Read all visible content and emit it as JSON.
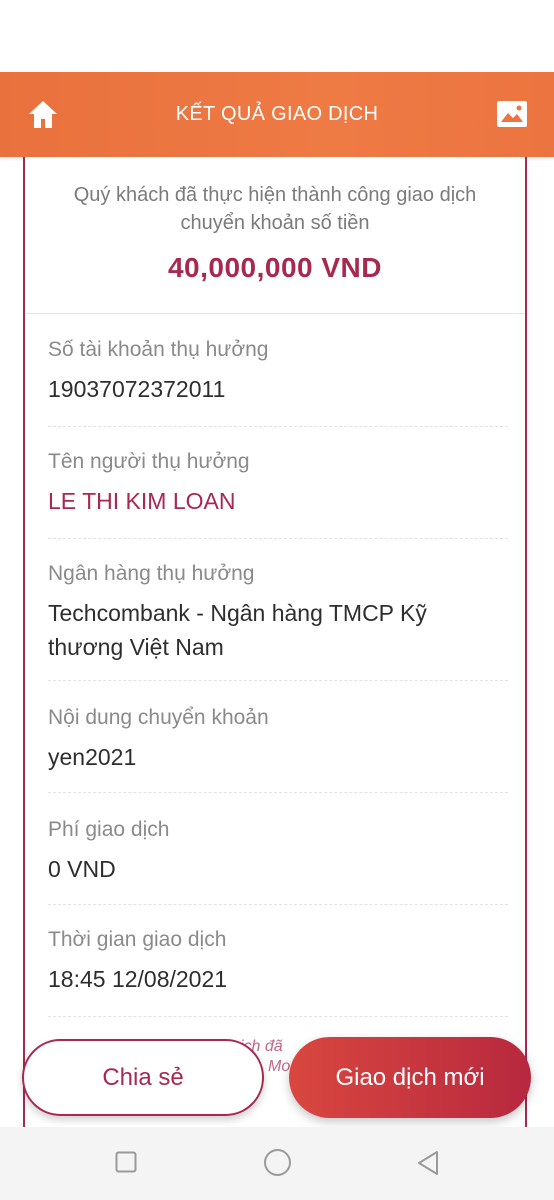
{
  "header": {
    "title": "KẾT QUẢ GIAO DỊCH",
    "home_icon": "home-icon",
    "image_icon": "image-icon"
  },
  "summary": {
    "message": "Quý khách đã thực hiện thành công giao dịch chuyển khoản số tiền",
    "amount": "40,000,000 VND"
  },
  "details": [
    {
      "label": "Số tài khoản thụ hưởng",
      "value": "19037072372011"
    },
    {
      "label": "Tên người thụ hưởng",
      "value": "LE THI KIM LOAN"
    },
    {
      "label": "Ngân hàng thụ hưởng",
      "value": "Techcombank - Ngân hàng TMCP Kỹ thương Việt Nam"
    },
    {
      "label": "Nội dung chuyển khoản",
      "value": "yen2021"
    },
    {
      "label": "Phí giao dịch",
      "value": "0 VND"
    },
    {
      "label": "Thời gian giao dịch",
      "value": "18:45 12/08/2021"
    }
  ],
  "footer_note": {
    "line1": "ịch đã",
    "line2": "Mo"
  },
  "actions": {
    "share_label": "Chia sẻ",
    "new_label": "Giao dịch mới"
  },
  "colors": {
    "header": "#ec7440",
    "accent": "#a8284f",
    "button_gradient_start": "#d9473f",
    "button_gradient_end": "#b7283f"
  }
}
